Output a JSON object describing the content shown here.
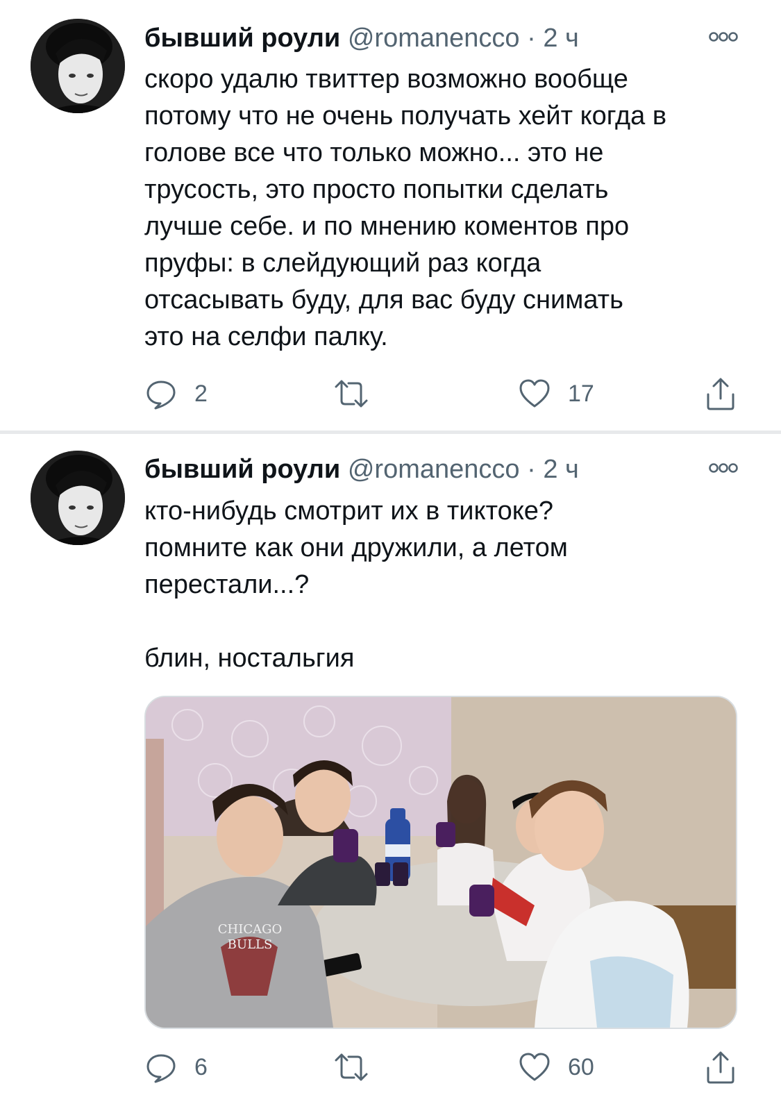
{
  "tweets": [
    {
      "author_name": "бывший роули",
      "handle": "@romanencco",
      "separator": "·",
      "time": "2 ч",
      "text": "скоро удалю твиттер возможно вообще\nпотому что не очень получать хейт когда в\nголове все что только можно... это не\nтрусость, это просто попытки сделать\nлучше себе. и по мнению коментов про\nпруфы: в слейдующий раз когда\nотсасывать буду, для вас буду снимать\nэто на селфи палку.",
      "replies": "2",
      "retweets": "",
      "likes": "17"
    },
    {
      "author_name": "бывший роули",
      "handle": "@romanencco",
      "separator": "·",
      "time": "2 ч",
      "text": "кто-нибудь смотрит их в тиктоке?\nпомните как они дружили, а летом\nперестали...?\n\nблин, ностальгия",
      "replies": "6",
      "retweets": "",
      "likes": "60",
      "media_jersey_text": "CHICAGO BULLS"
    }
  ],
  "icons": {
    "more": "more-horizontal-icon",
    "reply": "reply-icon",
    "retweet": "retweet-icon",
    "like": "heart-icon",
    "share": "share-icon"
  },
  "colors": {
    "text": "#0f1419",
    "secondary": "#536471",
    "divider": "#e7e9eb"
  }
}
